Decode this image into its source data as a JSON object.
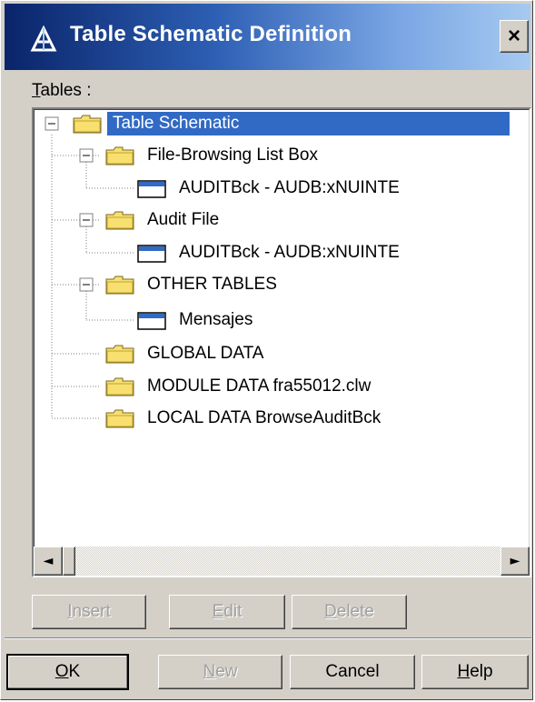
{
  "window": {
    "title": "Table Schematic Definition",
    "close_label": "×"
  },
  "tables_label": {
    "mnemonic": "T",
    "rest": "ables :"
  },
  "tree": {
    "items": [
      {
        "label": "Table Schematic",
        "icon": "folder-icon",
        "selected": true
      },
      {
        "label": "File-Browsing List Box",
        "icon": "folder-icon"
      },
      {
        "label": "AUDITBck - AUDB:xNUINTE",
        "icon": "table-icon"
      },
      {
        "label": "Audit File",
        "icon": "folder-icon"
      },
      {
        "label": "AUDITBck - AUDB:xNUINTE",
        "icon": "table-icon"
      },
      {
        "label": "OTHER TABLES",
        "icon": "folder-icon"
      },
      {
        "label": "Mensajes",
        "icon": "table-icon"
      },
      {
        "label": "GLOBAL DATA",
        "icon": "folder-icon"
      },
      {
        "label": "MODULE DATA fra55012.clw",
        "icon": "folder-icon"
      },
      {
        "label": "LOCAL DATA BrowseAuditBck",
        "icon": "folder-icon"
      }
    ]
  },
  "scroll": {
    "left_arrow": "◄",
    "right_arrow": "►"
  },
  "edit_buttons": {
    "insert": {
      "mnemonic": "I",
      "rest": "nsert"
    },
    "edit": {
      "mnemonic": "E",
      "rest": "dit"
    },
    "delete": {
      "mnemonic": "D",
      "rest": "elete"
    }
  },
  "dialog_buttons": {
    "ok": {
      "mnemonic": "O",
      "rest": "K"
    },
    "new": {
      "mnemonic": "N",
      "rest": "ew"
    },
    "cancel": "Cancel",
    "help": {
      "mnemonic": "H",
      "rest": "elp"
    }
  },
  "colors": {
    "title_bar_start": "#0a246a",
    "title_bar_end": "#a6caf0",
    "selection": "#316ac5",
    "folder_yellow": "#f8e070",
    "dialog_face": "#d4d0c8"
  }
}
